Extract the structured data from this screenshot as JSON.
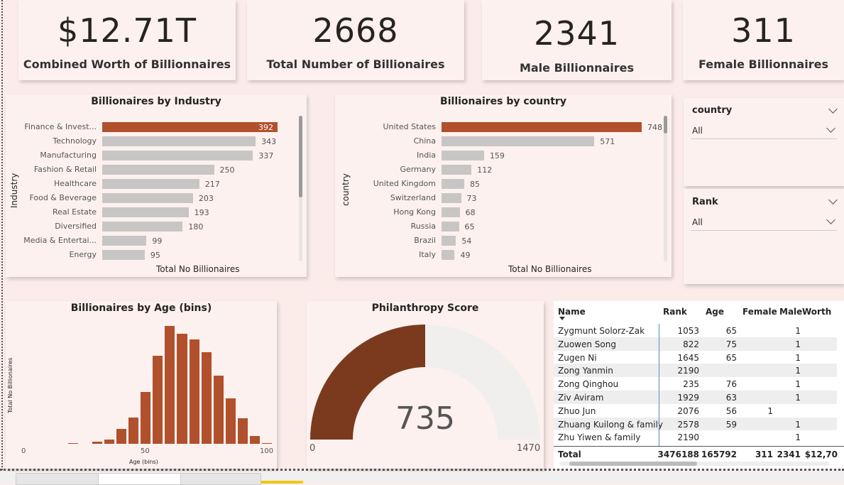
{
  "kpis": [
    {
      "value": "$12.71T",
      "label": "Combined Worth of Billionnaires"
    },
    {
      "value": "2668",
      "label": "Total Number of Billionaires"
    },
    {
      "value": "2341",
      "label": "Male Billionnaires"
    },
    {
      "value": "311",
      "label": "Female Billionnaires"
    }
  ],
  "industry_chart": {
    "title": "Billionaires by Industry",
    "ylabel": "Industry",
    "xlabel": "Total No Billionaires",
    "categories": [
      "Finance & Invest...",
      "Technology",
      "Manufacturing",
      "Fashion & Retail",
      "Healthcare",
      "Food & Beverage",
      "Real Estate",
      "Diversified",
      "Media & Entertai...",
      "Energy"
    ],
    "values": [
      392,
      343,
      337,
      250,
      217,
      203,
      193,
      180,
      99,
      95
    ],
    "highlight_color": "#b1502c",
    "bar_color": "#c8c6c4"
  },
  "country_chart": {
    "title": "Billionaires by country",
    "ylabel": "country",
    "xlabel": "Total No Billionaires",
    "categories": [
      "United States",
      "China",
      "India",
      "Germany",
      "United Kingdom",
      "Switzerland",
      "Hong Kong",
      "Russia",
      "Brazil",
      "Italy"
    ],
    "values": [
      748,
      571,
      159,
      112,
      85,
      73,
      68,
      65,
      54,
      49
    ]
  },
  "slicers": [
    {
      "title": "country",
      "value": "All"
    },
    {
      "title": "Rank",
      "value": "All"
    }
  ],
  "age_chart": {
    "title": "Billionaires by Age (bins)",
    "ylabel": "Total No Billionaires",
    "xlabel": "Age (bins)",
    "tick_labels": [
      "0",
      "50",
      "100"
    ],
    "bins": [
      20,
      25,
      30,
      35,
      40,
      45,
      50,
      55,
      60,
      65,
      70,
      75,
      80,
      85,
      90,
      95,
      100
    ],
    "values": [
      1,
      0,
      4,
      8,
      30,
      52,
      103,
      174,
      233,
      218,
      207,
      181,
      135,
      90,
      50,
      16,
      2
    ],
    "xlim": [
      0,
      100
    ]
  },
  "gauge": {
    "title": "Philanthropy Score",
    "value": "735",
    "min": "0",
    "max": "1470",
    "fraction": 0.5,
    "fill_color": "#7b3a1e",
    "track_color": "#f0efee"
  },
  "table": {
    "columns": [
      "Name",
      "Rank",
      "Age",
      "Female",
      "Male",
      "Worth"
    ],
    "rows": [
      [
        "Zygmunt Solorz-Zak",
        "1053",
        "65",
        "",
        "1"
      ],
      [
        "Zuowen Song",
        "822",
        "75",
        "",
        "1"
      ],
      [
        "Zugen Ni",
        "1645",
        "65",
        "",
        "1"
      ],
      [
        "Zong Yanmin",
        "2190",
        "",
        "",
        "1"
      ],
      [
        "Zong Qinghou",
        "235",
        "76",
        "",
        "1"
      ],
      [
        "Ziv Aviram",
        "1929",
        "63",
        "",
        "1"
      ],
      [
        "Zhuo Jun",
        "2076",
        "56",
        "1",
        ""
      ],
      [
        "Zhuang Kuilong & family",
        "2578",
        "59",
        "",
        "1"
      ],
      [
        "Zhu Yiwen & family",
        "2190",
        "",
        "",
        "1"
      ]
    ],
    "total": [
      "Total",
      "3476188",
      "165792",
      "311",
      "2341",
      "$12,70"
    ]
  }
}
